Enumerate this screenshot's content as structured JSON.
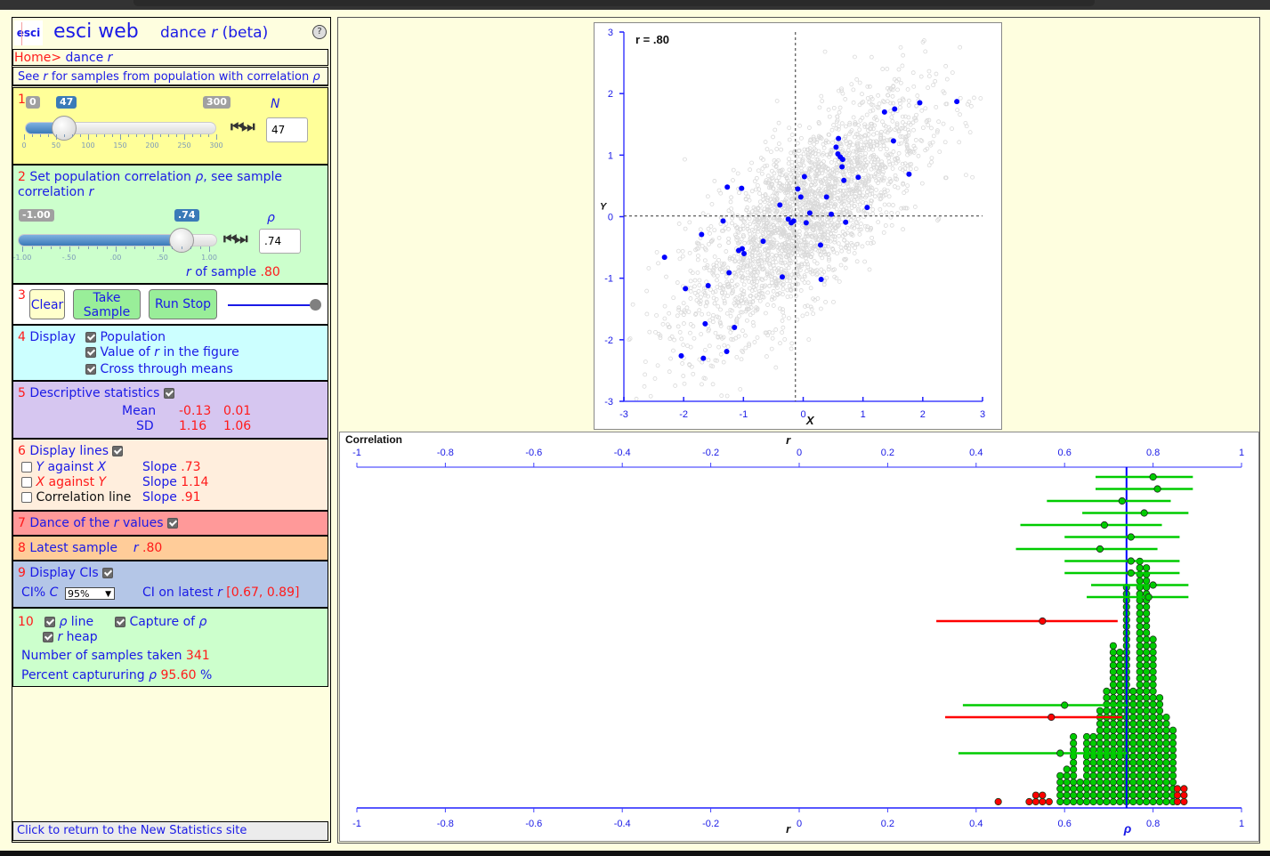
{
  "app": {
    "logo_text": "esci",
    "title": "esci web",
    "subtitle_prefix": "dance ",
    "subtitle_var": "r",
    "subtitle_suffix": " (beta)",
    "help_icon": "?"
  },
  "breadcrumb": {
    "home": "Home>",
    "current_prefix": " dance ",
    "current_var": "r"
  },
  "description": {
    "prefix": "See ",
    "var1": "r",
    "middle": " for samples from population with correlation ",
    "var2": "ρ"
  },
  "section1": {
    "number": "1",
    "min_label": "0",
    "value_label": "47",
    "max_label": "300",
    "fraction": 0.1567,
    "ticks": [
      "0",
      "50",
      "100",
      "150",
      "200",
      "250",
      "300"
    ],
    "var_label": "N",
    "input_value": "47",
    "stepper": "◀▶"
  },
  "section2": {
    "number": "2",
    "text_a": " Set population correlation ",
    "var_rho": "ρ",
    "text_b": ", see sample correlation ",
    "var_r": "r",
    "min_label": "-1.00",
    "value_label": ".74",
    "fraction": 0.87,
    "ticks": [
      "-1.00",
      "-.50",
      ".00",
      ".50",
      "1.00"
    ],
    "var_label": "ρ",
    "input_value": ".74",
    "r_of_sample_var": "r",
    "r_of_sample_label": " of sample ",
    "r_of_sample_value": ".80"
  },
  "section3": {
    "number": "3",
    "clear": "Clear",
    "take_sample": "Take Sample",
    "run_stop": "Run Stop",
    "speed_fraction": 1.0
  },
  "section4": {
    "number": "4",
    "label": " Display",
    "options": [
      {
        "label": "Population",
        "checked": true
      },
      {
        "label_a": "Value of ",
        "var": "r",
        "label_b": " in the figure",
        "checked": true
      },
      {
        "label": "Cross through means",
        "checked": true
      }
    ]
  },
  "section5": {
    "number": "5",
    "label": " Descriptive statistics",
    "checked": true,
    "mean_label": "Mean",
    "sd_label": "SD",
    "mean_x": "-0.13",
    "mean_y": "0.01",
    "sd_x": "1.16",
    "sd_y": "1.06"
  },
  "section6": {
    "number": "6",
    "label": " Display lines",
    "checked": true,
    "lines": [
      {
        "a": "Y",
        "mid": " against ",
        "b": "X",
        "slope_label": "Slope ",
        "slope": ".73",
        "checked": false
      },
      {
        "a": "X",
        "mid": " against ",
        "b": "Y",
        "slope_label": "Slope ",
        "slope": "1.14",
        "checked": false
      },
      {
        "name": "Correlation line",
        "slope_label": "Slope ",
        "slope": ".91",
        "checked": false
      }
    ]
  },
  "section7": {
    "number": "7",
    "label_a": " Dance of the ",
    "var": "r",
    "label_b": " values",
    "checked": true
  },
  "section8": {
    "number": "8",
    "label": " Latest sample",
    "var": "r",
    "value": " .80"
  },
  "section9": {
    "number": "9",
    "label": " Display CIs",
    "checked": true,
    "ci_label": "CI% ",
    "ci_var": "C",
    "ci_selected": "95%",
    "latest_label": "CI on latest ",
    "latest_var": "r",
    "latest_ci": "[0.67, 0.89]"
  },
  "section10": {
    "number": "10",
    "rho_line_var": "ρ",
    "rho_line_label": " line",
    "rho_line_checked": true,
    "capture_label": "Capture of ",
    "capture_var": "ρ",
    "capture_checked": true,
    "heap_var": "r",
    "heap_label": " heap",
    "heap_checked": true,
    "samples_label": "Number of samples taken ",
    "samples_value": "341",
    "percent_label": "Percent captururing ",
    "percent_var": "ρ",
    "percent_value": " 95.60",
    "percent_sign": " %"
  },
  "footer_link": "Click to return to the New Statistics site",
  "chart_data": [
    {
      "type": "scatter",
      "title": "",
      "annotation": "r = .80",
      "xlabel": "X",
      "ylabel": "Y",
      "xlim": [
        -3,
        3
      ],
      "ylim": [
        -3,
        3
      ],
      "xticks": [
        "-3",
        "-2",
        "-1",
        "0",
        "1",
        "2",
        "3"
      ],
      "yticks": [
        "-3",
        "-2",
        "-1",
        "0",
        "1",
        "2",
        "3"
      ],
      "cross_through_means": {
        "x": -0.13,
        "y": 0.01
      },
      "population": {
        "rho": 0.74,
        "color": "#d9d9d9",
        "n_display": 2500
      },
      "sample": {
        "color": "#0000ff",
        "points": [
          [
            2.57,
            1.87
          ],
          [
            1.95,
            1.85
          ],
          [
            1.53,
            1.75
          ],
          [
            1.36,
            1.7
          ],
          [
            1.51,
            1.23
          ],
          [
            1.77,
            0.69
          ],
          [
            0.59,
            1.27
          ],
          [
            0.55,
            1.13
          ],
          [
            0.58,
            1.02
          ],
          [
            0.62,
            0.97
          ],
          [
            0.66,
            0.93
          ],
          [
            0.65,
            0.81
          ],
          [
            0.68,
            0.59
          ],
          [
            0.92,
            0.64
          ],
          [
            0.02,
            0.65
          ],
          [
            -0.09,
            0.45
          ],
          [
            -0.04,
            0.32
          ],
          [
            0.39,
            0.32
          ],
          [
            0.11,
            0.06
          ],
          [
            0.47,
            0.04
          ],
          [
            1.07,
            0.15
          ],
          [
            0.71,
            -0.09
          ],
          [
            -0.39,
            0.19
          ],
          [
            -0.25,
            -0.04
          ],
          [
            -0.16,
            -0.07
          ],
          [
            -0.2,
            -0.1
          ],
          [
            0.05,
            -0.1
          ],
          [
            -1.27,
            0.48
          ],
          [
            -1.03,
            0.46
          ],
          [
            -1.34,
            -0.07
          ],
          [
            -1.7,
            -0.29
          ],
          [
            -0.67,
            -0.4
          ],
          [
            -1.02,
            -0.52
          ],
          [
            -1.08,
            -0.55
          ],
          [
            -0.99,
            -0.6
          ],
          [
            -2.32,
            -0.66
          ],
          [
            0.29,
            -0.46
          ],
          [
            -1.24,
            -0.91
          ],
          [
            -0.35,
            -0.98
          ],
          [
            0.3,
            -1.02
          ],
          [
            -1.59,
            -1.12
          ],
          [
            -1.97,
            -1.17
          ],
          [
            -1.64,
            -1.74
          ],
          [
            -1.15,
            -1.8
          ],
          [
            -1.28,
            -2.19
          ],
          [
            -2.04,
            -2.26
          ],
          [
            -1.67,
            -2.3
          ]
        ]
      }
    },
    {
      "type": "dot-heap-with-intervals",
      "title": "Correlation",
      "xlabel_top": "r",
      "xlabel_bottom": "r",
      "rho_marker": "ρ",
      "xlim": [
        -1,
        1
      ],
      "xticks": [
        "-1",
        "-0.8",
        "-0.6",
        "-0.4",
        "-0.2",
        "0",
        "0.2",
        "0.4",
        "0.6",
        "0.8",
        "1"
      ],
      "rho": 0.74,
      "capture_color": "#00cc00",
      "miss_color": "#ff0000",
      "rho_line_color": "#0000ff",
      "latest_intervals": [
        {
          "r": 0.8,
          "lo": 0.67,
          "hi": 0.89,
          "captures": true
        },
        {
          "r": 0.81,
          "lo": 0.67,
          "hi": 0.89,
          "captures": true
        },
        {
          "r": 0.73,
          "lo": 0.56,
          "hi": 0.84,
          "captures": true
        },
        {
          "r": 0.78,
          "lo": 0.64,
          "hi": 0.88,
          "captures": true
        },
        {
          "r": 0.69,
          "lo": 0.5,
          "hi": 0.82,
          "captures": true
        },
        {
          "r": 0.75,
          "lo": 0.6,
          "hi": 0.86,
          "captures": true
        },
        {
          "r": 0.68,
          "lo": 0.49,
          "hi": 0.81,
          "captures": true
        },
        {
          "r": 0.75,
          "lo": 0.6,
          "hi": 0.86,
          "captures": true
        },
        {
          "r": 0.75,
          "lo": 0.6,
          "hi": 0.86,
          "captures": true
        },
        {
          "r": 0.8,
          "lo": 0.66,
          "hi": 0.88,
          "captures": true
        },
        {
          "r": 0.79,
          "lo": 0.65,
          "hi": 0.88,
          "captures": true
        },
        {
          "r": 0.55,
          "lo": 0.31,
          "hi": 0.72,
          "captures": false
        },
        {
          "r": 0.6,
          "lo": 0.37,
          "hi": 0.74,
          "captures": true
        },
        {
          "r": 0.57,
          "lo": 0.33,
          "hi": 0.73,
          "captures": false
        },
        {
          "r": 0.59,
          "lo": 0.36,
          "hi": 0.74,
          "captures": true
        }
      ],
      "heap_columns": [
        {
          "r": 0.45,
          "count": 1,
          "captures": false
        },
        {
          "r": 0.52,
          "count": 1,
          "captures": false
        },
        {
          "r": 0.535,
          "count": 2,
          "captures": false
        },
        {
          "r": 0.55,
          "count": 2,
          "captures": false
        },
        {
          "r": 0.565,
          "count": 1,
          "captures": false
        },
        {
          "r": 0.59,
          "count": 5,
          "captures": true
        },
        {
          "r": 0.605,
          "count": 6,
          "captures": true
        },
        {
          "r": 0.62,
          "count": 11,
          "captures": true
        },
        {
          "r": 0.635,
          "count": 4,
          "captures": true
        },
        {
          "r": 0.65,
          "count": 11,
          "captures": true
        },
        {
          "r": 0.665,
          "count": 11,
          "captures": true
        },
        {
          "r": 0.68,
          "count": 15,
          "captures": true
        },
        {
          "r": 0.695,
          "count": 18,
          "captures": true
        },
        {
          "r": 0.71,
          "count": 25,
          "captures": true
        },
        {
          "r": 0.725,
          "count": 24,
          "captures": true
        },
        {
          "r": 0.74,
          "count": 34,
          "captures": true
        },
        {
          "r": 0.755,
          "count": 18,
          "captures": true
        },
        {
          "r": 0.77,
          "count": 38,
          "captures": true
        },
        {
          "r": 0.785,
          "count": 37,
          "captures": true
        },
        {
          "r": 0.8,
          "count": 26,
          "captures": true
        },
        {
          "r": 0.815,
          "count": 17,
          "captures": true
        },
        {
          "r": 0.83,
          "count": 14,
          "captures": true
        },
        {
          "r": 0.845,
          "count": 12,
          "captures": true
        },
        {
          "r": 0.855,
          "count": 3,
          "captures": false
        },
        {
          "r": 0.87,
          "count": 3,
          "captures": false
        }
      ]
    }
  ]
}
